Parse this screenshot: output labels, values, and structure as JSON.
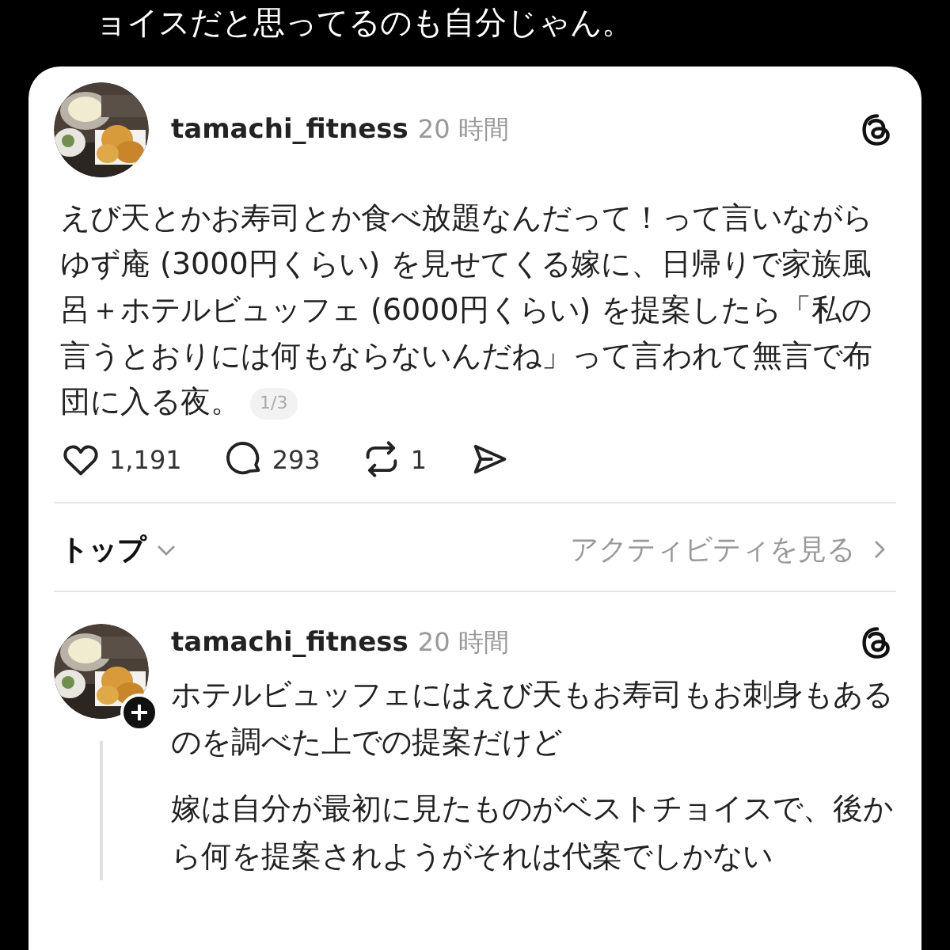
{
  "caption_fragment": "ョイスだと思ってるのも自分じゃん。",
  "post": {
    "username": "tamachi_fitness",
    "time": "20 時間",
    "text": "えび天とかお寿司とか食べ放題なんだって！って言いながらゆず庵 (3000円くらい) を見せてくる嫁に、日帰りで家族風呂＋ホテルビュッフェ (6000円くらい) を提案したら「私の言うとおりには何もならないんだね」って言われて無言で布団に入る夜。",
    "page_indicator": "1/3",
    "actions": [
      {
        "kind": "like",
        "count": "1,191"
      },
      {
        "kind": "reply",
        "count": "293"
      },
      {
        "kind": "repost",
        "count": "1"
      },
      {
        "kind": "share"
      }
    ]
  },
  "sort": {
    "label": "トップ",
    "activity_link": "アクティビティを見る"
  },
  "reply": {
    "username": "tamachi_fitness",
    "time": "20 時間",
    "paragraphs": [
      "ホテルビュッフェにはえび天もお寿司もお刺身もあるのを調べた上での提案だけど",
      "嫁は自分が最初に見たものがベストチョイスで、後から何を提案されようがそれは代案でしかない"
    ]
  }
}
